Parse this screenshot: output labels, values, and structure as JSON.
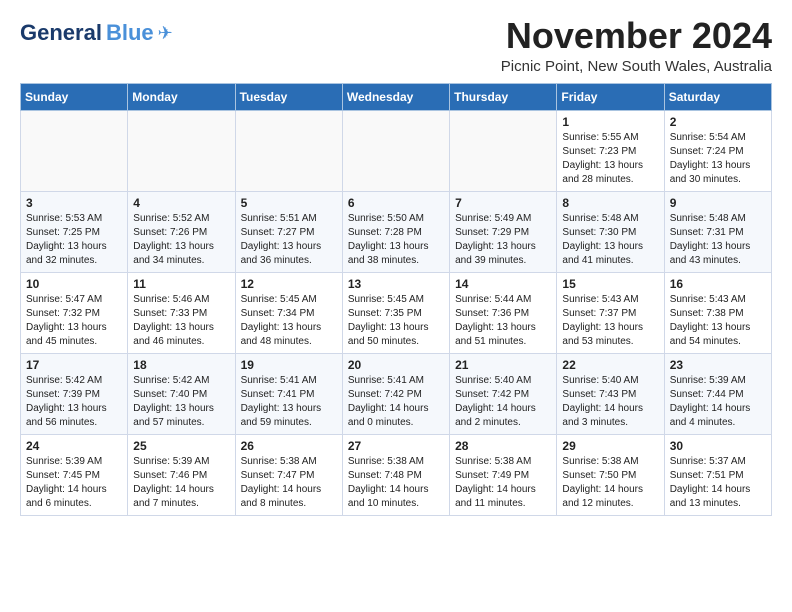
{
  "app": {
    "logo_general": "General",
    "logo_blue": "Blue",
    "month": "November 2024",
    "location": "Picnic Point, New South Wales, Australia"
  },
  "calendar": {
    "headers": [
      "Sunday",
      "Monday",
      "Tuesday",
      "Wednesday",
      "Thursday",
      "Friday",
      "Saturday"
    ],
    "weeks": [
      [
        {
          "day": "",
          "info": ""
        },
        {
          "day": "",
          "info": ""
        },
        {
          "day": "",
          "info": ""
        },
        {
          "day": "",
          "info": ""
        },
        {
          "day": "",
          "info": ""
        },
        {
          "day": "1",
          "info": "Sunrise: 5:55 AM\nSunset: 7:23 PM\nDaylight: 13 hours\nand 28 minutes."
        },
        {
          "day": "2",
          "info": "Sunrise: 5:54 AM\nSunset: 7:24 PM\nDaylight: 13 hours\nand 30 minutes."
        }
      ],
      [
        {
          "day": "3",
          "info": "Sunrise: 5:53 AM\nSunset: 7:25 PM\nDaylight: 13 hours\nand 32 minutes."
        },
        {
          "day": "4",
          "info": "Sunrise: 5:52 AM\nSunset: 7:26 PM\nDaylight: 13 hours\nand 34 minutes."
        },
        {
          "day": "5",
          "info": "Sunrise: 5:51 AM\nSunset: 7:27 PM\nDaylight: 13 hours\nand 36 minutes."
        },
        {
          "day": "6",
          "info": "Sunrise: 5:50 AM\nSunset: 7:28 PM\nDaylight: 13 hours\nand 38 minutes."
        },
        {
          "day": "7",
          "info": "Sunrise: 5:49 AM\nSunset: 7:29 PM\nDaylight: 13 hours\nand 39 minutes."
        },
        {
          "day": "8",
          "info": "Sunrise: 5:48 AM\nSunset: 7:30 PM\nDaylight: 13 hours\nand 41 minutes."
        },
        {
          "day": "9",
          "info": "Sunrise: 5:48 AM\nSunset: 7:31 PM\nDaylight: 13 hours\nand 43 minutes."
        }
      ],
      [
        {
          "day": "10",
          "info": "Sunrise: 5:47 AM\nSunset: 7:32 PM\nDaylight: 13 hours\nand 45 minutes."
        },
        {
          "day": "11",
          "info": "Sunrise: 5:46 AM\nSunset: 7:33 PM\nDaylight: 13 hours\nand 46 minutes."
        },
        {
          "day": "12",
          "info": "Sunrise: 5:45 AM\nSunset: 7:34 PM\nDaylight: 13 hours\nand 48 minutes."
        },
        {
          "day": "13",
          "info": "Sunrise: 5:45 AM\nSunset: 7:35 PM\nDaylight: 13 hours\nand 50 minutes."
        },
        {
          "day": "14",
          "info": "Sunrise: 5:44 AM\nSunset: 7:36 PM\nDaylight: 13 hours\nand 51 minutes."
        },
        {
          "day": "15",
          "info": "Sunrise: 5:43 AM\nSunset: 7:37 PM\nDaylight: 13 hours\nand 53 minutes."
        },
        {
          "day": "16",
          "info": "Sunrise: 5:43 AM\nSunset: 7:38 PM\nDaylight: 13 hours\nand 54 minutes."
        }
      ],
      [
        {
          "day": "17",
          "info": "Sunrise: 5:42 AM\nSunset: 7:39 PM\nDaylight: 13 hours\nand 56 minutes."
        },
        {
          "day": "18",
          "info": "Sunrise: 5:42 AM\nSunset: 7:40 PM\nDaylight: 13 hours\nand 57 minutes."
        },
        {
          "day": "19",
          "info": "Sunrise: 5:41 AM\nSunset: 7:41 PM\nDaylight: 13 hours\nand 59 minutes."
        },
        {
          "day": "20",
          "info": "Sunrise: 5:41 AM\nSunset: 7:42 PM\nDaylight: 14 hours\nand 0 minutes."
        },
        {
          "day": "21",
          "info": "Sunrise: 5:40 AM\nSunset: 7:42 PM\nDaylight: 14 hours\nand 2 minutes."
        },
        {
          "day": "22",
          "info": "Sunrise: 5:40 AM\nSunset: 7:43 PM\nDaylight: 14 hours\nand 3 minutes."
        },
        {
          "day": "23",
          "info": "Sunrise: 5:39 AM\nSunset: 7:44 PM\nDaylight: 14 hours\nand 4 minutes."
        }
      ],
      [
        {
          "day": "24",
          "info": "Sunrise: 5:39 AM\nSunset: 7:45 PM\nDaylight: 14 hours\nand 6 minutes."
        },
        {
          "day": "25",
          "info": "Sunrise: 5:39 AM\nSunset: 7:46 PM\nDaylight: 14 hours\nand 7 minutes."
        },
        {
          "day": "26",
          "info": "Sunrise: 5:38 AM\nSunset: 7:47 PM\nDaylight: 14 hours\nand 8 minutes."
        },
        {
          "day": "27",
          "info": "Sunrise: 5:38 AM\nSunset: 7:48 PM\nDaylight: 14 hours\nand 10 minutes."
        },
        {
          "day": "28",
          "info": "Sunrise: 5:38 AM\nSunset: 7:49 PM\nDaylight: 14 hours\nand 11 minutes."
        },
        {
          "day": "29",
          "info": "Sunrise: 5:38 AM\nSunset: 7:50 PM\nDaylight: 14 hours\nand 12 minutes."
        },
        {
          "day": "30",
          "info": "Sunrise: 5:37 AM\nSunset: 7:51 PM\nDaylight: 14 hours\nand 13 minutes."
        }
      ]
    ]
  }
}
